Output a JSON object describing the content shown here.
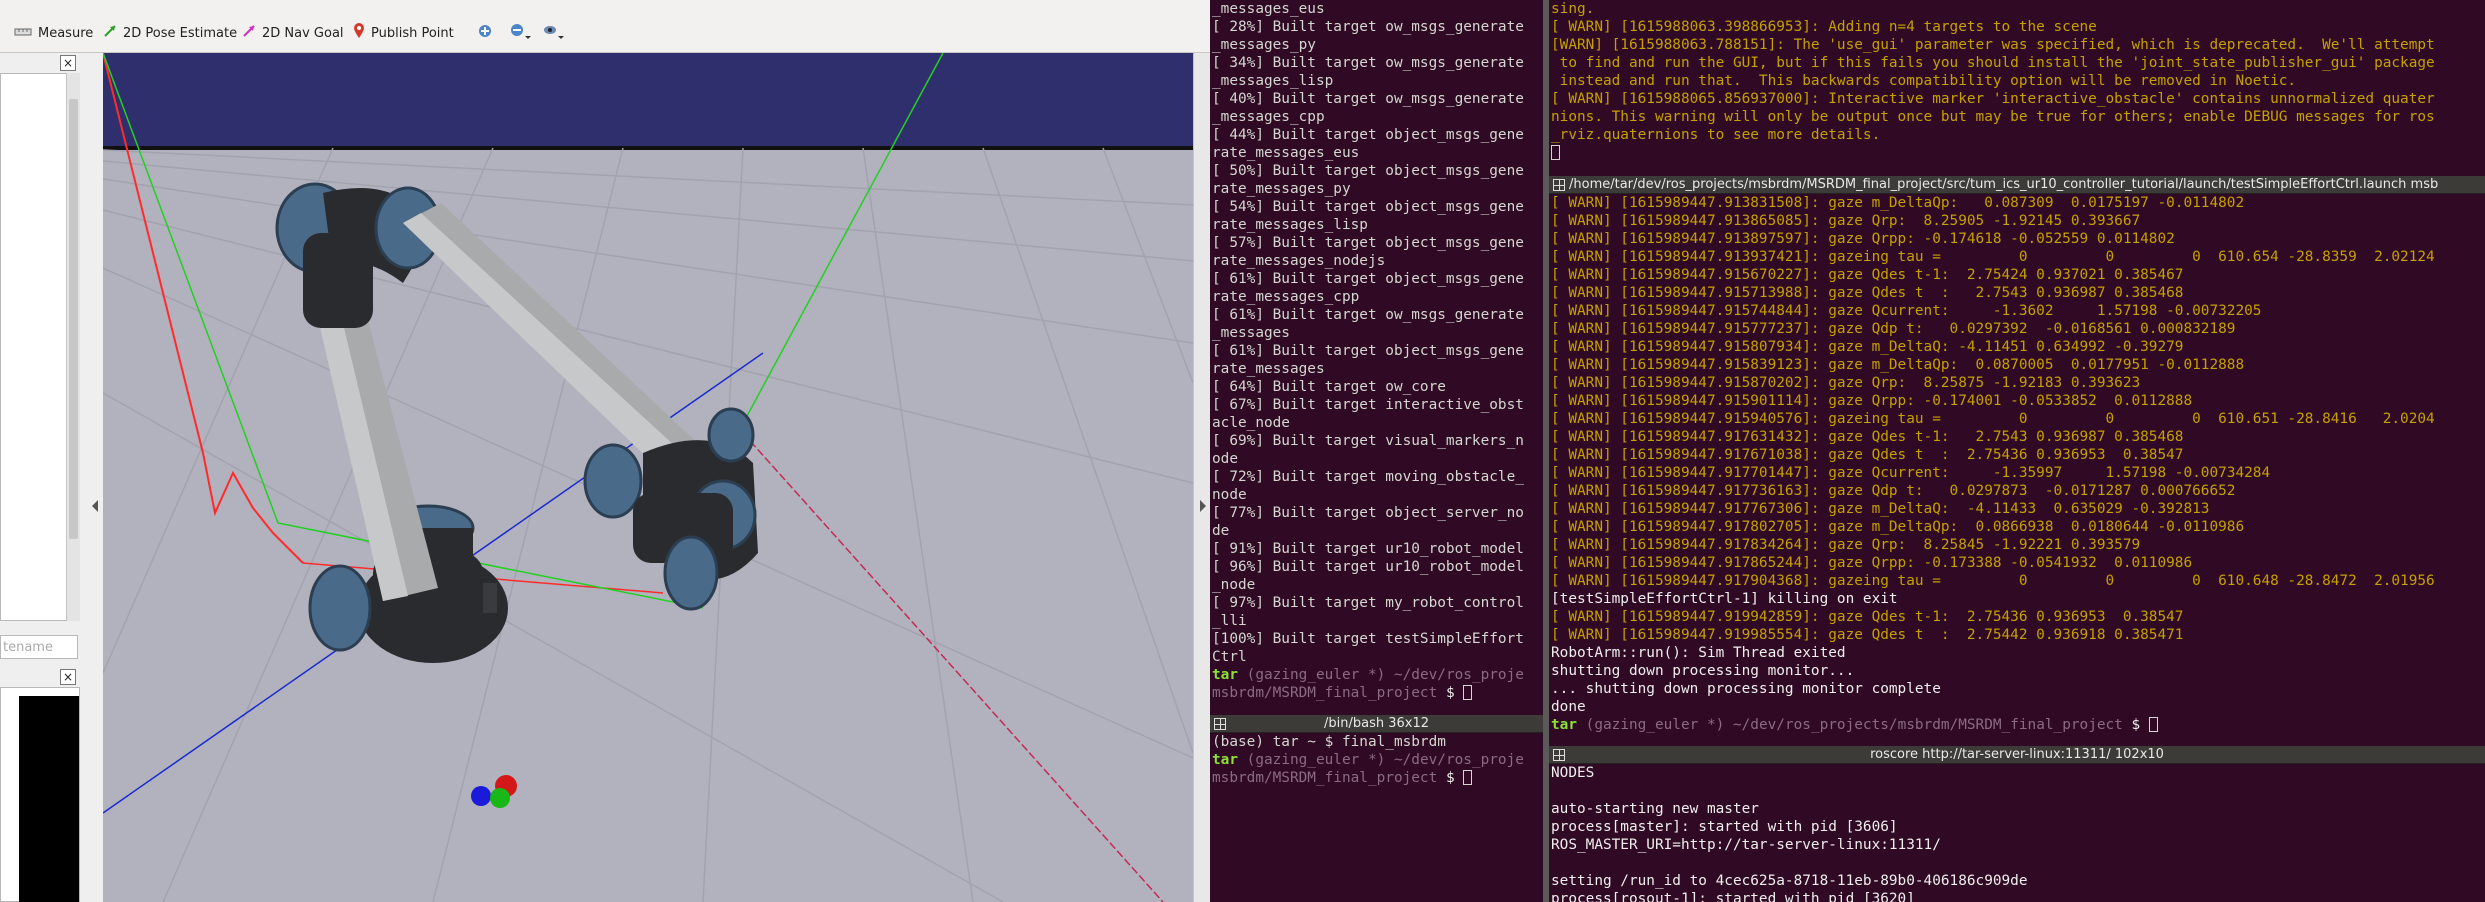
{
  "rviz": {
    "toolbar": {
      "tools": [
        {
          "label": "Measure",
          "icon": "ruler-icon"
        },
        {
          "label": "2D Pose Estimate",
          "icon": "green-arrow-icon"
        },
        {
          "label": "2D Nav Goal",
          "icon": "pink-arrow-icon"
        },
        {
          "label": "Publish Point",
          "icon": "map-pin-icon"
        }
      ],
      "view_icons": [
        "plus-icon",
        "minus-icon",
        "eye-icon"
      ]
    },
    "left_panel": {
      "filter_placeholder": "tename"
    },
    "colors": {
      "sky": "#2f2f6a",
      "floor": "#b1b2bd",
      "robot_body": "#2a2b2e",
      "robot_links": "#a9aaac",
      "robot_caps": "#4a6a8a"
    }
  },
  "build_terminal": {
    "lines": [
      "_messages_eus",
      "[ 28%] Built target ow_msgs_generate",
      "_messages_py",
      "[ 34%] Built target ow_msgs_generate",
      "_messages_lisp",
      "[ 40%] Built target ow_msgs_generate",
      "_messages_cpp",
      "[ 44%] Built target object_msgs_gene",
      "rate_messages_eus",
      "[ 50%] Built target object_msgs_gene",
      "rate_messages_py",
      "[ 54%] Built target object_msgs_gene",
      "rate_messages_lisp",
      "[ 57%] Built target object_msgs_gene",
      "rate_messages_nodejs",
      "[ 61%] Built target object_msgs_gene",
      "rate_messages_cpp",
      "[ 61%] Built target ow_msgs_generate",
      "_messages",
      "[ 61%] Built target object_msgs_gene",
      "rate_messages",
      "[ 64%] Built target ow_core",
      "[ 67%] Built target interactive_obst",
      "acle_node",
      "[ 69%] Built target visual_markers_n",
      "ode",
      "[ 72%] Built target moving_obstacle_",
      "node",
      "[ 77%] Built target object_server_no",
      "de",
      "[ 91%] Built target ur10_robot_model",
      "[ 96%] Built target ur10_robot_model",
      "_node",
      "[ 97%] Built target my_robot_control",
      "_lli",
      "[100%] Built target testSimpleEffort",
      "Ctrl"
    ],
    "prompt_user": "tar",
    "prompt_git": "(gazing_euler *)",
    "prompt_path_1": "~/dev/ros_proje",
    "prompt_path_2": "msbrdm/MSRDM_final_project",
    "prompt_dollar": "$"
  },
  "bash_terminal": {
    "title": "/bin/bash 36x12",
    "cmd_line": "(base) tar ~ $ final_msbrdm",
    "prompt_user": "tar",
    "prompt_git": "(gazing_euler *)",
    "prompt_path_1": "~/dev/ros_proje",
    "prompt_path_2": "msbrdm/MSRDM_final_project",
    "prompt_dollar": "$"
  },
  "top_terminal": {
    "lines": [
      {
        "text": "sing.",
        "style": "warn"
      },
      {
        "text": "[ WARN] [1615988063.398866953]: Adding n=4 targets to the scene",
        "style": "warn"
      },
      {
        "text": "[WARN] [1615988063.788151]: The 'use_gui' parameter was specified, which is deprecated.  We'll attempt",
        "style": "warn"
      },
      {
        "text": " to find and run the GUI, but if this fails you should install the 'joint_state_publisher_gui' package",
        "style": "warn"
      },
      {
        "text": " instead and run that.  This backwards compatibility option will be removed in Noetic.",
        "style": "warn"
      },
      {
        "text": "[ WARN] [1615988065.856937000]: Interactive marker 'interactive_obstacle' contains unnormalized quater",
        "style": "warn"
      },
      {
        "text": "nions. This warning will only be output once but may be true for others; enable DEBUG messages for ros",
        "style": "warn"
      },
      {
        "text": "_rviz.quaternions to see more details.",
        "style": "warn"
      }
    ]
  },
  "launch_terminal": {
    "title": "/home/tar/dev/ros_projects/msbrdm/MSRDM_final_project/src/tum_ics_ur10_controller_tutorial/launch/testSimpleEffortCtrl.launch msb",
    "lines": [
      {
        "text": "[ WARN] [1615989447.913831508]: gaze m_DeltaQp:   0.087309  0.0175197 -0.0114802",
        "style": "warn"
      },
      {
        "text": "[ WARN] [1615989447.913865085]: gaze Qrp:  8.25905 -1.92145 0.393667",
        "style": "warn"
      },
      {
        "text": "[ WARN] [1615989447.913897597]: gaze Qrpp: -0.174618 -0.052559 0.0114802",
        "style": "warn"
      },
      {
        "text": "[ WARN] [1615989447.913937421]: gazeing tau =         0         0         0  610.654 -28.8359  2.02124",
        "style": "warn"
      },
      {
        "text": "[ WARN] [1615989447.915670227]: gaze Qdes t-1:  2.75424 0.937021 0.385467",
        "style": "warn"
      },
      {
        "text": "[ WARN] [1615989447.915713988]: gaze Qdes t  :   2.7543 0.936987 0.385468",
        "style": "warn"
      },
      {
        "text": "[ WARN] [1615989447.915744844]: gaze Qcurrent:     -1.3602     1.57198 -0.00732205",
        "style": "warn"
      },
      {
        "text": "[ WARN] [1615989447.915777237]: gaze Qdp t:   0.0297392  -0.0168561 0.000832189",
        "style": "warn"
      },
      {
        "text": "[ WARN] [1615989447.915807934]: gaze m_DeltaQ: -4.11451 0.634992 -0.39279",
        "style": "warn"
      },
      {
        "text": "[ WARN] [1615989447.915839123]: gaze m_DeltaQp:  0.0870005  0.0177951 -0.0112888",
        "style": "warn"
      },
      {
        "text": "[ WARN] [1615989447.915870202]: gaze Qrp:  8.25875 -1.92183 0.393623",
        "style": "warn"
      },
      {
        "text": "[ WARN] [1615989447.915901114]: gaze Qrpp: -0.174001 -0.0533852  0.0112888",
        "style": "warn"
      },
      {
        "text": "[ WARN] [1615989447.915940576]: gazeing tau =         0         0         0  610.651 -28.8416   2.0204",
        "style": "warn"
      },
      {
        "text": "[ WARN] [1615989447.917631432]: gaze Qdes t-1:   2.7543 0.936987 0.385468",
        "style": "warn"
      },
      {
        "text": "[ WARN] [1615989447.917671038]: gaze Qdes t  :  2.75436 0.936953  0.38547",
        "style": "warn"
      },
      {
        "text": "[ WARN] [1615989447.917701447]: gaze Qcurrent:     -1.35997     1.57198 -0.00734284",
        "style": "warn"
      },
      {
        "text": "[ WARN] [1615989447.917736163]: gaze Qdp t:   0.0297873  -0.0171287 0.000766652",
        "style": "warn"
      },
      {
        "text": "[ WARN] [1615989447.917767306]: gaze m_DeltaQ:  -4.11433  0.635029 -0.392813",
        "style": "warn"
      },
      {
        "text": "[ WARN] [1615989447.917802705]: gaze m_DeltaQp:  0.0866938  0.0180644 -0.0110986",
        "style": "warn"
      },
      {
        "text": "[ WARN] [1615989447.917834264]: gaze Qrp:  8.25845 -1.92221 0.393579",
        "style": "warn"
      },
      {
        "text": "[ WARN] [1615989447.917865244]: gaze Qrpp: -0.173388 -0.0541932  0.0110986",
        "style": "warn"
      },
      {
        "text": "[ WARN] [1615989447.917904368]: gazeing tau =         0         0         0  610.648 -28.8472  2.01956",
        "style": "warn"
      },
      {
        "text": "[testSimpleEffortCtrl-1] killing on exit",
        "style": "normal"
      },
      {
        "text": "[ WARN] [1615989447.919942859]: gaze Qdes t-1:  2.75436 0.936953  0.38547",
        "style": "warn"
      },
      {
        "text": "[ WARN] [1615989447.919985554]: gaze Qdes t  :  2.75442 0.936918 0.385471",
        "style": "warn"
      },
      {
        "text": "RobotArm::run(): Sim Thread exited",
        "style": "normal"
      },
      {
        "text": "shutting down processing monitor...",
        "style": "normal"
      },
      {
        "text": "... shutting down processing monitor complete",
        "style": "normal"
      },
      {
        "text": "done",
        "style": "normal"
      }
    ],
    "prompt_user": "tar",
    "prompt_git": "(gazing_euler *)",
    "prompt_path": "~/dev/ros_projects/msbrdm/MSRDM_final_project",
    "prompt_dollar": "$"
  },
  "roscore_terminal": {
    "title": "roscore http://tar-server-linux:11311/ 102x10",
    "lines": [
      "NODES",
      "",
      "auto-starting new master",
      "process[master]: started with pid [3606]",
      "ROS_MASTER_URI=http://tar-server-linux:11311/",
      "",
      "setting /run_id to 4cec625a-8718-11eb-89b0-406186c909de",
      "process[rosout-1]: started with pid [3620]"
    ]
  }
}
